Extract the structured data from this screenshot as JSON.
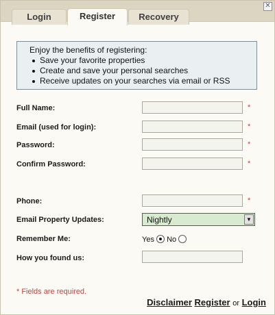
{
  "tabs": [
    {
      "label": "Login"
    },
    {
      "label": "Register"
    },
    {
      "label": "Recovery"
    }
  ],
  "close_icon": "✕",
  "benefits": {
    "intro": "Enjoy the benefits of registering:",
    "items": [
      "Save your favorite properties",
      "Create and save your personal searches",
      "Receive updates on your searches via email or RSS"
    ]
  },
  "form": {
    "full_name_label": "Full Name:",
    "email_label": "Email (used for login):",
    "password_label": "Password:",
    "confirm_password_label": "Confirm Password:",
    "phone_label": "Phone:",
    "updates_label": "Email Property Updates:",
    "updates_value": "Nightly",
    "remember_label": "Remember Me:",
    "remember_yes": "Yes",
    "remember_no": "No",
    "found_label": "How you found us:",
    "required_mark": "*"
  },
  "footer": {
    "required_note": "* Fields are required.",
    "disclaimer": "Disclaimer",
    "register": "Register",
    "or": "or",
    "login": "Login"
  }
}
